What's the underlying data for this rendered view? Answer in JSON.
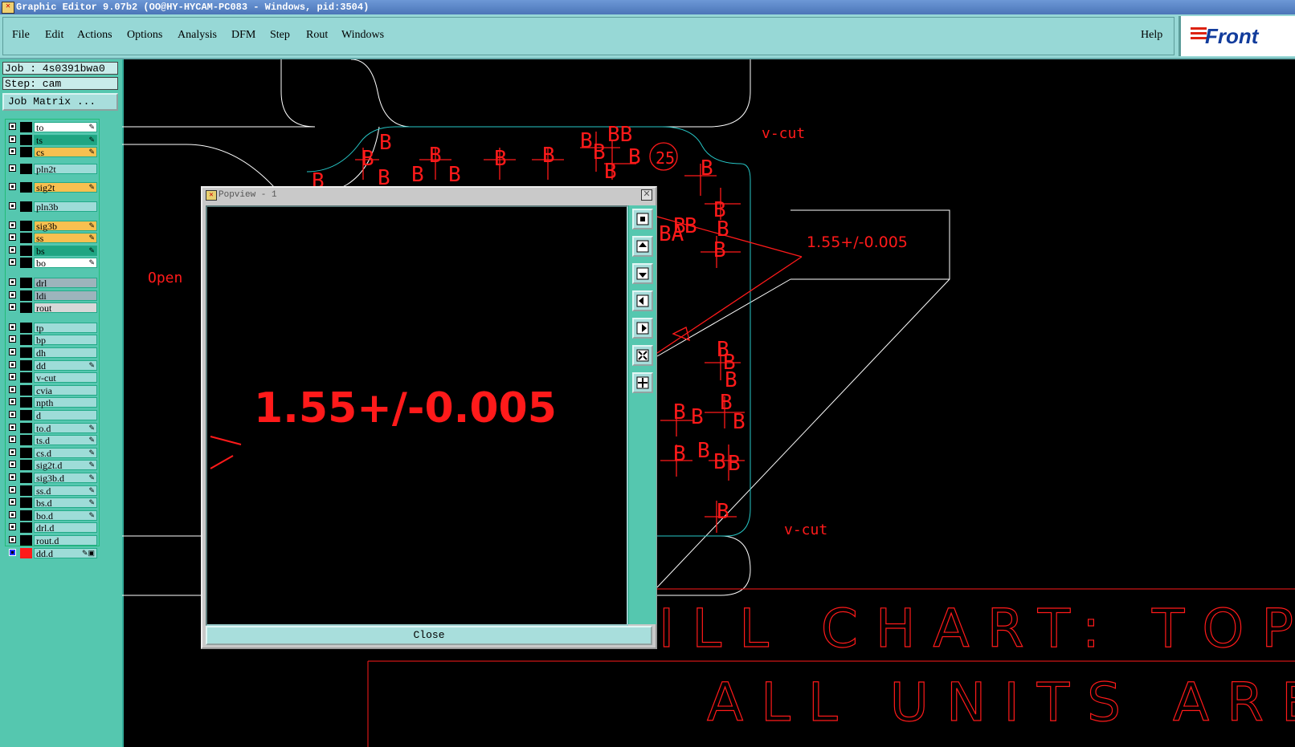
{
  "window": {
    "title": "Graphic Editor 9.07b2 (OO@HY-HYCAM-PC083 - Windows, pid:3504)"
  },
  "menubar": {
    "items": [
      "File",
      "Edit",
      "Actions",
      "Options",
      "Analysis",
      "DFM",
      "Step",
      "Rout",
      "Windows"
    ],
    "help": "Help",
    "logo": "Front"
  },
  "job": {
    "name": "Job : 4s0391bwa0",
    "step": "Step: cam",
    "matrix_button": "Job Matrix ..."
  },
  "layers": [
    {
      "name": "to",
      "color": "#ffffff",
      "flag": "✎"
    },
    {
      "name": "ts",
      "color": "#1fa582",
      "flag": "✎"
    },
    {
      "name": "cs",
      "color": "#f8c050",
      "flag": "✎"
    },
    {
      "name": "pln2t",
      "color": "#9edcd8",
      "flag": ""
    },
    {
      "name": "sig2t",
      "color": "#f8c050",
      "flag": "✎"
    },
    {
      "name": "pln3b",
      "color": "#9edcd8",
      "flag": ""
    },
    {
      "name": "sig3b",
      "color": "#f8c050",
      "flag": "✎"
    },
    {
      "name": "ss",
      "color": "#f8c050",
      "flag": "✎"
    },
    {
      "name": "bs",
      "color": "#1fa582",
      "flag": "✎"
    },
    {
      "name": "bo",
      "color": "#ffffff",
      "flag": "✎"
    },
    {
      "name": "drl",
      "color": "#9db4bc",
      "flag": ""
    },
    {
      "name": "ldi",
      "color": "#9db4bc",
      "flag": ""
    },
    {
      "name": "rout",
      "color": "#d8d8d8",
      "flag": ""
    },
    {
      "name": "tp",
      "color": "#9edcd8",
      "flag": ""
    },
    {
      "name": "bp",
      "color": "#9edcd8",
      "flag": ""
    },
    {
      "name": "dh",
      "color": "#9edcd8",
      "flag": ""
    },
    {
      "name": "dd",
      "color": "#9edcd8",
      "flag": "✎"
    },
    {
      "name": "v-cut",
      "color": "#9edcd8",
      "flag": ""
    },
    {
      "name": "cvia",
      "color": "#9edcd8",
      "flag": ""
    },
    {
      "name": "npth",
      "color": "#9edcd8",
      "flag": ""
    },
    {
      "name": "d",
      "color": "#9edcd8",
      "flag": ""
    },
    {
      "name": "to.d",
      "color": "#9edcd8",
      "flag": "✎"
    },
    {
      "name": "ts.d",
      "color": "#9edcd8",
      "flag": "✎"
    },
    {
      "name": "cs.d",
      "color": "#9edcd8",
      "flag": "✎"
    },
    {
      "name": "sig2t.d",
      "color": "#9edcd8",
      "flag": "✎"
    },
    {
      "name": "sig3b.d",
      "color": "#9edcd8",
      "flag": "✎"
    },
    {
      "name": "ss.d",
      "color": "#9edcd8",
      "flag": "✎"
    },
    {
      "name": "bs.d",
      "color": "#9edcd8",
      "flag": "✎"
    },
    {
      "name": "bo.d",
      "color": "#9edcd8",
      "flag": "✎"
    },
    {
      "name": "drl.d",
      "color": "#9edcd8",
      "flag": ""
    },
    {
      "name": "rout.d",
      "color": "#9edcd8",
      "flag": ""
    },
    {
      "name": "dd.d",
      "color": "#9edcd8",
      "flag": "✎▣",
      "active": true
    }
  ],
  "canvas": {
    "labels": {
      "vcut1": "v-cut",
      "vcut2": "v-cut",
      "open": "Open",
      "tolerance": "1.55+/-0.005",
      "chart_title": "RILL CHART: TOP",
      "units": "ALL UNITS ARE I"
    },
    "colors": {
      "feature": "#ff1a1a",
      "outline": "#ffffff",
      "profile": "#27c7c7"
    }
  },
  "popview": {
    "title": "Popview - 1",
    "zoom_text": "1.55+/-0.005",
    "close_label": "Close",
    "tools": [
      "zoom-home-icon",
      "pan-up-icon",
      "pan-down-icon",
      "pan-left-icon",
      "pan-right-icon",
      "zoom-in-icon",
      "zoom-out-icon"
    ]
  }
}
